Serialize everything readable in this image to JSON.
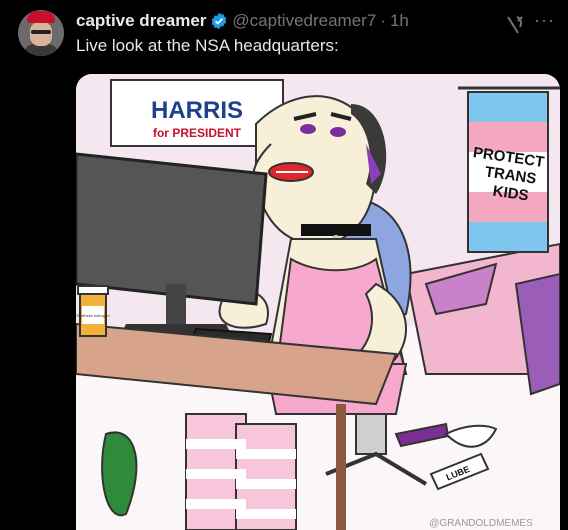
{
  "post": {
    "display_name": "captive dreamer",
    "handle": "@captivedreamer7",
    "separator": "·",
    "time": "1h",
    "text": "Live look at the NSA headquarters:",
    "more_label": "···"
  },
  "media": {
    "sign": {
      "line1": "HARRIS",
      "line2": "for PRESIDENT"
    },
    "flag": {
      "line1": "PROTECT",
      "line2": "TRANS",
      "line3": "KIDS"
    },
    "bottle_label": "Synthetic estrogen",
    "lube_label": "LUBE",
    "watermark": "@GRANDOLDMEMES"
  },
  "colors": {
    "background": "#000000",
    "text": "#e7e9ea",
    "muted": "#71767b",
    "verified": "#1d9bf0",
    "sign_blue": "#1f3f8f",
    "sign_red": "#c8102e",
    "flag_blue": "#7fc6ee",
    "flag_pink": "#f4a9c0"
  },
  "icons": {
    "verified": "verified-badge-icon",
    "grok": "grok-icon",
    "more": "more-options-icon"
  }
}
